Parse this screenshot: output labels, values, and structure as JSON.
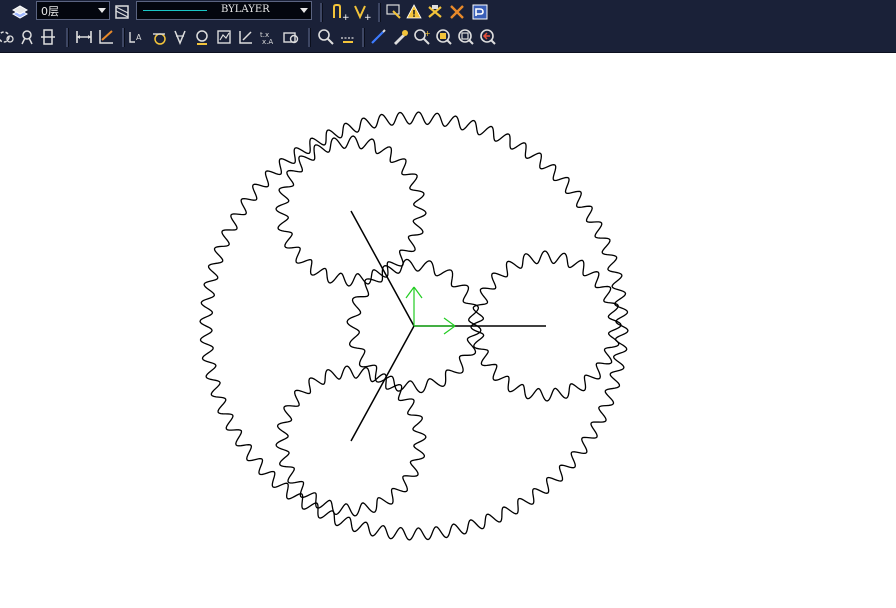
{
  "toolbar": {
    "layer_value": "0层",
    "linetype_value": "BYLAYER",
    "row1_icons": [
      "layers-icon",
      "layer-props-icon",
      "linetype-icon",
      "text-insert-icon",
      "text-edit-icon",
      "select-objects-icon",
      "warning-icon",
      "erase-icon",
      "move-icon",
      "properties-icon"
    ],
    "row2_icons": [
      "snap-icon",
      "pan-icon",
      "object-icon",
      "dimension-linear-icon",
      "dimension-angle-icon",
      "dimension-radius-icon",
      "dimension-diameter-icon",
      "tolerance-icon",
      "leader-icon",
      "ordinate-icon",
      "qdim-icon",
      "dim-style-icon",
      "dim-update-icon",
      "zoom-realtime-icon",
      "zoom-window-icon",
      "measure-icon",
      "pencil-icon",
      "zoom-dynamic-icon",
      "zoom-all-icon",
      "zoom-extents-icon",
      "zoom-previous-icon",
      "zoom-scale-icon"
    ]
  },
  "drawing": {
    "accent_black": "#000000",
    "ucs_color": "#22cc22",
    "ring_gear_teeth": 72,
    "planet_gear_teeth": 24,
    "sun_gear_teeth": 18
  }
}
